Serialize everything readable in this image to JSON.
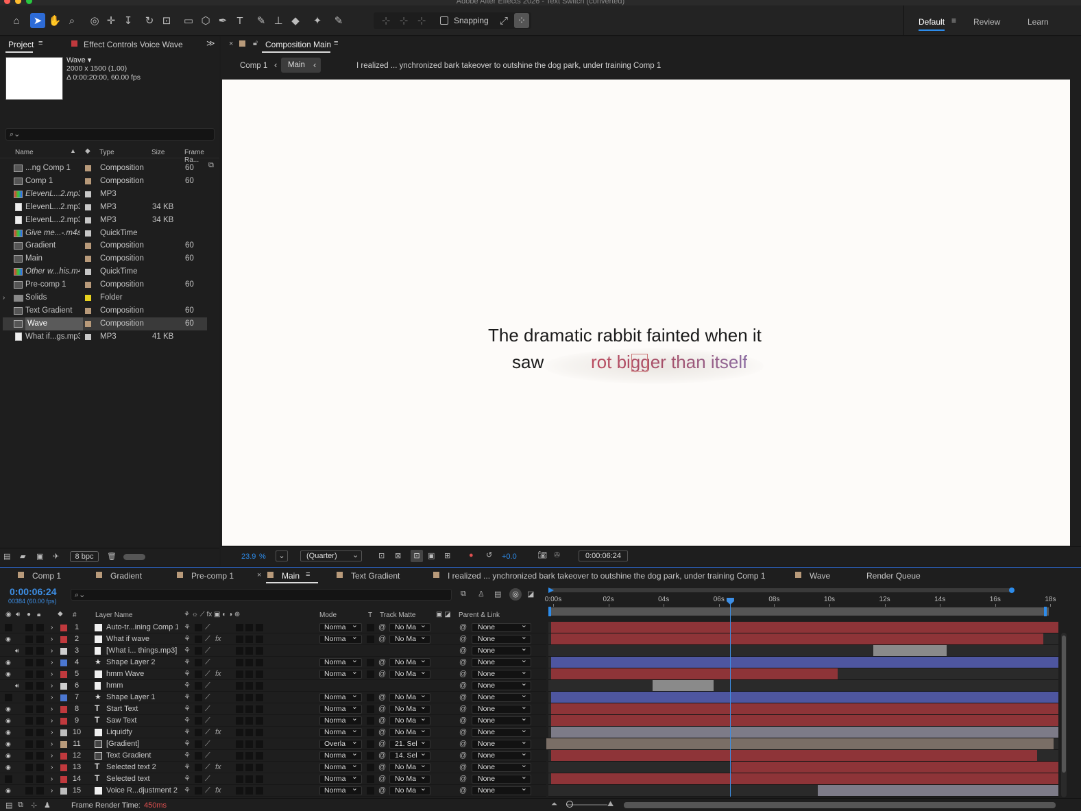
{
  "app": {
    "title": "Adobe After Effects 2026 - Text Switch (converted)"
  },
  "toolbar": {
    "snapping_label": "Snapping",
    "workspaces": [
      "Default",
      "Review",
      "Learn"
    ]
  },
  "project_panel": {
    "tab_project": "Project",
    "tab_effect_controls": "Effect Controls Voice Wave",
    "selected_name": "Wave ▾",
    "selected_dims": "2000 x 1500 (1.00)",
    "selected_duration": "Δ 0:00:20:00, 60.00 fps",
    "search_placeholder": "",
    "columns": [
      "Name",
      "Type",
      "Size",
      "Frame Ra..."
    ],
    "items": [
      {
        "name": "...ng Comp 1",
        "type": "Composition",
        "size": "",
        "fps": "60",
        "icon": "comp",
        "color": "#b89a7a"
      },
      {
        "name": "Comp 1",
        "type": "Composition",
        "size": "",
        "fps": "60",
        "icon": "comp",
        "color": "#b89a7a"
      },
      {
        "name": "ElevenL...2.mp3",
        "type": "MP3",
        "size": "",
        "fps": "",
        "icon": "mp3c",
        "color": "#c7c7c7",
        "italic": true
      },
      {
        "name": "ElevenL...2.mp3",
        "type": "MP3",
        "size": "34 KB",
        "fps": "",
        "icon": "file",
        "color": "#c7c7c7"
      },
      {
        "name": "ElevenL...2.mp3",
        "type": "MP3",
        "size": "34 KB",
        "fps": "",
        "icon": "file",
        "color": "#c7c7c7"
      },
      {
        "name": "Give me...-.m4a",
        "type": "QuickTime",
        "size": "",
        "fps": "",
        "icon": "mp3c",
        "color": "#c7c7c7",
        "italic": true
      },
      {
        "name": "Gradient",
        "type": "Composition",
        "size": "",
        "fps": "60",
        "icon": "comp",
        "color": "#b89a7a"
      },
      {
        "name": "Main",
        "type": "Composition",
        "size": "",
        "fps": "60",
        "icon": "comp",
        "color": "#b89a7a"
      },
      {
        "name": "Other w...his.m4a",
        "type": "QuickTime",
        "size": "",
        "fps": "",
        "icon": "mp3c",
        "color": "#c7c7c7",
        "italic": true
      },
      {
        "name": "Pre-comp 1",
        "type": "Composition",
        "size": "",
        "fps": "60",
        "icon": "comp",
        "color": "#b89a7a"
      },
      {
        "name": "Solids",
        "type": "Folder",
        "size": "",
        "fps": "",
        "icon": "folder",
        "color": "#e8d21e"
      },
      {
        "name": "Text Gradient",
        "type": "Composition",
        "size": "",
        "fps": "60",
        "icon": "comp",
        "color": "#b89a7a"
      },
      {
        "name": "Wave",
        "type": "Composition",
        "size": "",
        "fps": "60",
        "icon": "comp",
        "color": "#b89a7a",
        "selected": true
      },
      {
        "name": "What if...gs.mp3",
        "type": "MP3",
        "size": "41 KB",
        "fps": "",
        "icon": "file",
        "color": "#c7c7c7"
      }
    ],
    "bpc": "8 bpc"
  },
  "composition_panel": {
    "tab_label": "Composition Main",
    "breadcrumbs": [
      "Comp 1",
      "Main",
      "I realized ... ynchronized bark takeover to outshine the dog park, under training Comp 1"
    ],
    "line1": "The dramatic rabbit fainted when it",
    "line2_a": "saw",
    "line2_b": "rot bigger than itself",
    "zoom": "23.9",
    "zoom_unit": "%",
    "resolution": "(Quarter)",
    "exposure": "+0.0",
    "timecode": "0:00:06:24"
  },
  "timeline": {
    "tabs": [
      {
        "label": "Comp 1",
        "color": "#b89a7a"
      },
      {
        "label": "Gradient",
        "color": "#b89a7a"
      },
      {
        "label": "Pre-comp 1",
        "color": "#b89a7a"
      },
      {
        "label": "Main",
        "color": "#b89a7a",
        "active": true
      },
      {
        "label": "Text Gradient",
        "color": "#b89a7a"
      },
      {
        "label": "I realized ... ynchronized bark takeover to outshine the dog park, under training Comp 1",
        "color": "#b89a7a"
      },
      {
        "label": "Wave",
        "color": "#b89a7a"
      },
      {
        "label": "Render Queue",
        "color": ""
      }
    ],
    "current_time": "0:00:06:24",
    "frame_info": "00384 (60.00 fps)",
    "columns": {
      "layer_name": "Layer Name",
      "mode": "Mode",
      "t": "T",
      "track_matte": "Track Matte",
      "parent": "Parent & Link"
    },
    "ruler": [
      "0:00s",
      "02s",
      "04s",
      "06s",
      "08s",
      "10s",
      "12s",
      "14s",
      "16s",
      "18s"
    ],
    "playhead_seconds": 6.4,
    "footer": "Frame Render Time:",
    "render_time": "450ms",
    "layers": [
      {
        "num": "1",
        "name": "Auto-tr...ining Comp 1",
        "color": "#c0393d",
        "icon": "solid",
        "mode": "Norma",
        "matte": "No Ma",
        "parent": "None",
        "eye": false,
        "fx": false,
        "bar": {
          "start": 0,
          "end": 1,
          "color": "#8e3438"
        }
      },
      {
        "num": "2",
        "name": "What if wave",
        "color": "#c0393d",
        "icon": "solid",
        "mode": "Norma",
        "matte": "No Ma",
        "parent": "None",
        "eye": true,
        "fx": true,
        "bar": {
          "start": 0,
          "end": 0.97,
          "color": "#8e3438"
        }
      },
      {
        "num": "3",
        "name": "[What i... things.mp3]",
        "color": "#cfcfcf",
        "icon": "file",
        "mode": "",
        "matte": "",
        "parent": "None",
        "eye": false,
        "audio": true,
        "fx": false,
        "bar": {
          "start": 0.635,
          "end": 0.78,
          "color": "#8a8a8a"
        }
      },
      {
        "num": "4",
        "name": "Shape Layer 2",
        "color": "#4b77d1",
        "icon": "star",
        "mode": "Norma",
        "matte": "No Ma",
        "parent": "None",
        "eye": true,
        "fx": false,
        "bar": {
          "start": 0,
          "end": 1,
          "color": "#4e56a0"
        }
      },
      {
        "num": "5",
        "name": "hmm Wave",
        "color": "#c0393d",
        "icon": "solid",
        "mode": "Norma",
        "matte": "No Ma",
        "parent": "None",
        "eye": true,
        "fx": true,
        "bar": {
          "start": 0,
          "end": 0.565,
          "color": "#8e3438"
        }
      },
      {
        "num": "6",
        "name": "hmm",
        "color": "#cfcfcf",
        "icon": "file",
        "mode": "",
        "matte": "",
        "parent": "None",
        "eye": false,
        "audio": true,
        "fx": false,
        "bar": {
          "start": 0.2,
          "end": 0.32,
          "color": "#8a8a8a"
        }
      },
      {
        "num": "7",
        "name": "Shape Layer 1",
        "color": "#4b77d1",
        "icon": "star",
        "mode": "Norma",
        "matte": "No Ma",
        "parent": "None",
        "eye": false,
        "fx": false,
        "bar": {
          "start": 0,
          "end": 1,
          "color": "#4e56a0"
        }
      },
      {
        "num": "8",
        "name": "Start Text",
        "color": "#c0393d",
        "icon": "t",
        "mode": "Norma",
        "matte": "No Ma",
        "parent": "None",
        "eye": true,
        "fx": false,
        "bar": {
          "start": 0,
          "end": 1,
          "color": "#8e3438"
        }
      },
      {
        "num": "9",
        "name": "Saw Text",
        "color": "#c0393d",
        "icon": "t",
        "mode": "Norma",
        "matte": "No Ma",
        "parent": "None",
        "eye": true,
        "fx": false,
        "bar": {
          "start": 0,
          "end": 1,
          "color": "#8e3438"
        }
      },
      {
        "num": "10",
        "name": "Liquidfy",
        "color": "#bdbdbd",
        "icon": "solid",
        "mode": "Norma",
        "matte": "No Ma",
        "parent": "None",
        "eye": true,
        "fx": true,
        "bar": {
          "start": 0,
          "end": 1,
          "color": "#7d7b88"
        }
      },
      {
        "num": "11",
        "name": "[Gradient]",
        "color": "#b89a7a",
        "icon": "comp",
        "mode": "Overla",
        "matte": "21. Sel",
        "parent": "None",
        "eye": true,
        "fx": false,
        "bar": {
          "start": -0.01,
          "end": 0.99,
          "color": "#7a6e66"
        }
      },
      {
        "num": "12",
        "name": "Text Gradient",
        "color": "#c0393d",
        "icon": "comp",
        "mode": "Norma",
        "matte": "14. Sel",
        "parent": "None",
        "eye": true,
        "fx": false,
        "bar": {
          "start": 0,
          "end": 0.958,
          "color": "#8e3438"
        }
      },
      {
        "num": "13",
        "name": "Selected text 2",
        "color": "#c0393d",
        "icon": "t",
        "mode": "Norma",
        "matte": "No Ma",
        "parent": "None",
        "eye": true,
        "fx": true,
        "bar": {
          "start": 0.355,
          "end": 1,
          "color": "#8e3438"
        }
      },
      {
        "num": "14",
        "name": "Selected text",
        "color": "#c0393d",
        "icon": "t",
        "mode": "Norma",
        "matte": "No Ma",
        "parent": "None",
        "eye": false,
        "fx": false,
        "bar": {
          "start": 0,
          "end": 1,
          "color": "#8e3438"
        }
      },
      {
        "num": "15",
        "name": "Voice R...djustment 2",
        "color": "#bdbdbd",
        "icon": "solid",
        "mode": "Norma",
        "matte": "No Ma",
        "parent": "None",
        "eye": true,
        "fx": true,
        "bar": {
          "start": 0.525,
          "end": 1,
          "color": "#7d7b88"
        }
      }
    ]
  }
}
